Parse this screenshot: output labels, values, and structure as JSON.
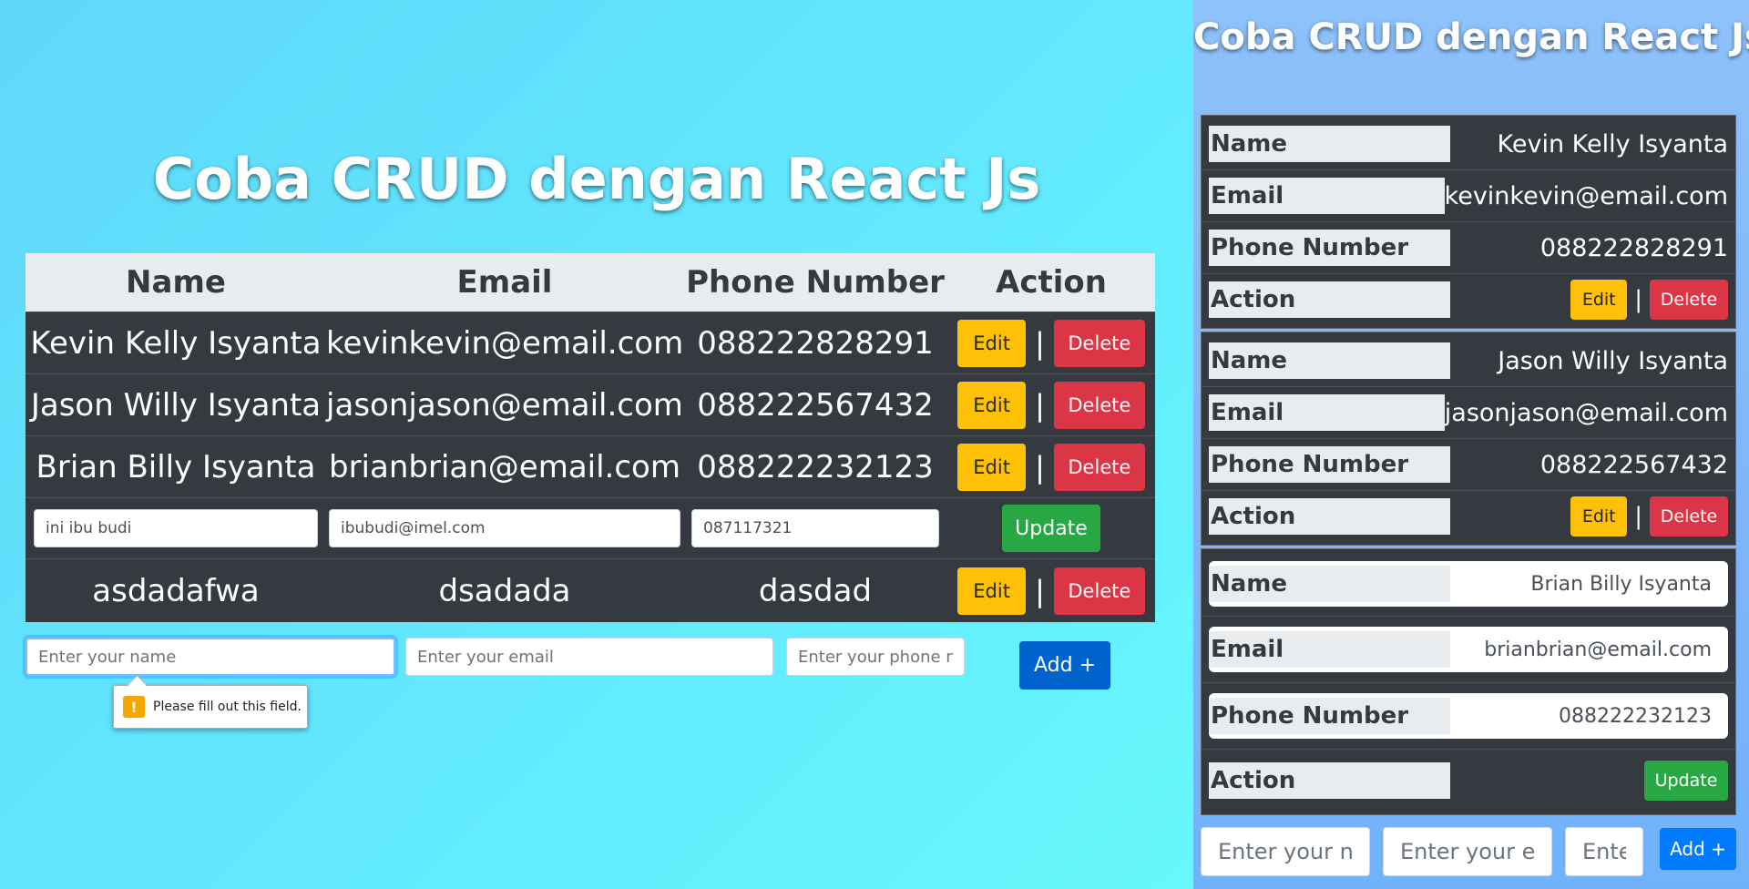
{
  "app": {
    "title": "Coba CRUD dengan React Js"
  },
  "table": {
    "headers": [
      "Name",
      "Email",
      "Phone Number",
      "Action"
    ],
    "rows": [
      {
        "name": "Kevin Kelly Isyanta",
        "email": "kevinkevin@email.com",
        "phone": "088222828291"
      },
      {
        "name": "Jason Willy Isyanta",
        "email": "jasonjason@email.com",
        "phone": "088222567432"
      },
      {
        "name": "Brian Billy Isyanta",
        "email": "brianbrian@email.com",
        "phone": "088222232123"
      },
      {
        "name": "asdadafwa",
        "email": "dsadada",
        "phone": "dasdad"
      }
    ],
    "edit_row": {
      "name_value": "ini ibu budi",
      "email_value": "ibubudi@imel.com",
      "phone_value": "087117321"
    },
    "separator": "|"
  },
  "buttons": {
    "edit": "Edit",
    "delete": "Delete",
    "update": "Update",
    "add": "Add +"
  },
  "form": {
    "name_placeholder": "Enter your name",
    "email_placeholder": "Enter your email",
    "phone_placeholder": "Enter your phone number"
  },
  "validation": {
    "message": "Please fill out this field.",
    "icon": "!"
  },
  "mobile": {
    "labels": {
      "name": "Name",
      "email": "Email",
      "phone": "Phone Number",
      "action": "Action"
    },
    "cards": [
      {
        "name": "Kevin Kelly Isyanta",
        "email": "kevinkevin@email.com",
        "phone": "088222828291"
      },
      {
        "name": "Jason Willy Isyanta",
        "email": "jasonjason@email.com",
        "phone": "088222567432"
      },
      {
        "name": "Brian Billy Isyanta",
        "email": "brianbrian@email.com",
        "phone": "088222232123"
      }
    ]
  },
  "colors": {
    "edit": "#ffc107",
    "delete": "#dc3545",
    "update": "#28a745",
    "add": "#0062cc",
    "table_dark": "#343a40",
    "header_light": "#e9ecef"
  }
}
